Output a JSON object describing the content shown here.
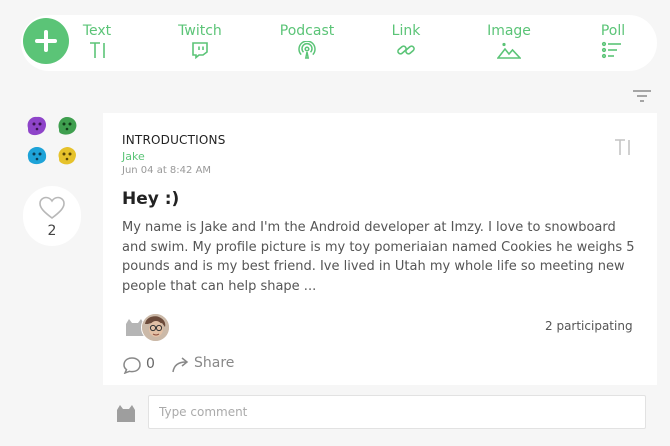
{
  "composer": {
    "add_icon": "plus-icon",
    "accent_color": "#5bc477",
    "post_types": [
      {
        "label": "Text",
        "icon": "text-cursor-icon"
      },
      {
        "label": "Twitch",
        "icon": "twitch-icon"
      },
      {
        "label": "Podcast",
        "icon": "podcast-icon"
      },
      {
        "label": "Link",
        "icon": "link-icon"
      },
      {
        "label": "Image",
        "icon": "image-icon"
      },
      {
        "label": "Poll",
        "icon": "poll-icon"
      }
    ]
  },
  "feed": {
    "filter_icon": "filter-icon",
    "likes": {
      "count": "2",
      "icon": "heart-icon"
    },
    "post": {
      "channel": "INTRODUCTIONS",
      "author": "Jake",
      "timestamp": "Jun 04 at 8:42 AM",
      "type_icon": "text-cursor-icon",
      "title": "Hey :)",
      "body": "My name is Jake and I'm the Android developer at Imzy. I love to snowboard and swim. My profile picture is my toy pomeriaian named Cookies he weighs 5 pounds and is my best friend. Ive lived in Utah my whole life so meeting new people that can help shape ...",
      "participants_label": "2 participating",
      "comment_count": "0",
      "share_label": "Share"
    },
    "comment_box": {
      "placeholder": "Type comment"
    }
  }
}
